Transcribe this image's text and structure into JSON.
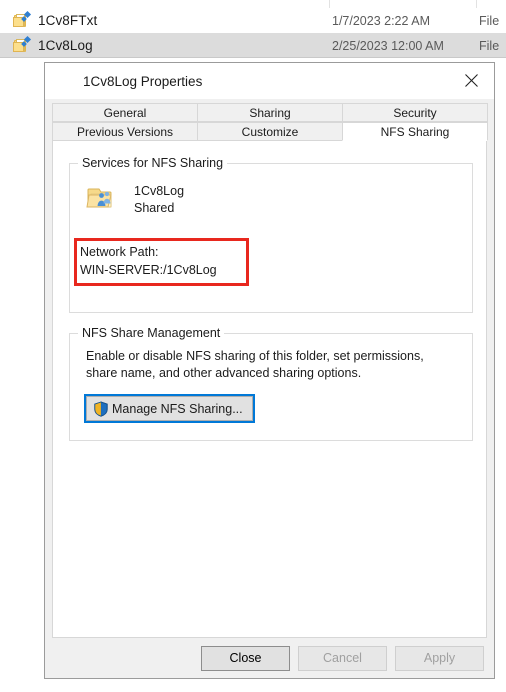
{
  "explorer": {
    "rows": [
      {
        "name": "1Cv8FTxt",
        "date": "1/7/2023 2:22 AM",
        "type": "File",
        "icon": "folder-shortcut-icon",
        "selected": false
      },
      {
        "name": "1Cv8Log",
        "date": "2/25/2023 12:00 AM",
        "type": "File",
        "icon": "folder-shortcut-icon",
        "selected": true
      }
    ]
  },
  "dialog": {
    "title": "1Cv8Log Properties",
    "title_icon": "folder-shortcut-icon",
    "close_icon": "close-icon",
    "tabs_row1": [
      {
        "label": "General",
        "selected": false
      },
      {
        "label": "Sharing",
        "selected": false
      },
      {
        "label": "Security",
        "selected": false
      }
    ],
    "tabs_row2": [
      {
        "label": "Previous Versions",
        "selected": false
      },
      {
        "label": "Customize",
        "selected": false
      },
      {
        "label": "NFS Sharing",
        "selected": true
      }
    ],
    "services_group": {
      "title": "Services for NFS Sharing",
      "share_icon": "shared-folder-icon",
      "share_name": "1Cv8Log",
      "share_status": "Shared",
      "network_path_label": "Network Path:",
      "network_path_value": "WIN-SERVER:/1Cv8Log",
      "highlight_color": "#e8281e"
    },
    "management_group": {
      "title": "NFS Share Management",
      "description_line1": "Enable or disable NFS sharing of this folder, set permissions,",
      "description_line2": "share name, and other advanced sharing options.",
      "manage_button_label": "Manage NFS Sharing...",
      "manage_button_icon": "uac-shield-icon",
      "focus_color": "#0078d7"
    },
    "footer": {
      "close_label": "Close",
      "cancel_label": "Cancel",
      "apply_label": "Apply"
    }
  }
}
